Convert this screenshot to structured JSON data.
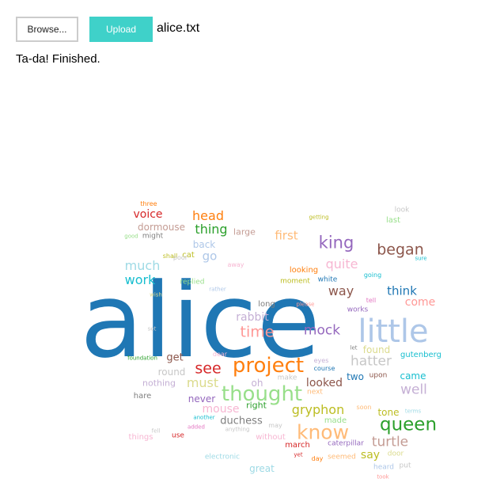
{
  "controls": {
    "browse_label": "Browse...",
    "upload_label": "Upload",
    "file_name": "alice.txt",
    "status": "Ta-da! Finished."
  },
  "word_cloud": {
    "words": [
      {
        "text": "alice",
        "color": "#1f77b4"
      },
      {
        "text": "little",
        "color": "#aec7e8"
      },
      {
        "text": "project",
        "color": "#ff7f0e"
      },
      {
        "text": "thought",
        "color": "#98df8a"
      },
      {
        "text": "know",
        "color": "#ffbb78"
      },
      {
        "text": "queen",
        "color": "#2ca02c"
      },
      {
        "text": "king",
        "color": "#9467bd"
      },
      {
        "text": "began",
        "color": "#8c564b"
      },
      {
        "text": "time",
        "color": "#ff9896"
      },
      {
        "text": "see",
        "color": "#d62728"
      },
      {
        "text": "mock",
        "color": "#9467bd"
      },
      {
        "text": "hatter",
        "color": "#c7c7c7"
      },
      {
        "text": "well",
        "color": "#c5b0d5"
      },
      {
        "text": "turtle",
        "color": "#c49c94"
      },
      {
        "text": "gryphon",
        "color": "#bcbd22"
      },
      {
        "text": "head",
        "color": "#ff7f0e"
      },
      {
        "text": "thing",
        "color": "#2ca02c"
      },
      {
        "text": "quite",
        "color": "#f7b6d2"
      },
      {
        "text": "much",
        "color": "#9edae5"
      },
      {
        "text": "work",
        "color": "#17becf"
      },
      {
        "text": "way",
        "color": "#8c564b"
      },
      {
        "text": "think",
        "color": "#1f77b4"
      },
      {
        "text": "must",
        "color": "#dbdb8d"
      },
      {
        "text": "voice",
        "color": "#d62728"
      },
      {
        "text": "first",
        "color": "#ffbb78"
      },
      {
        "text": "rabbit",
        "color": "#c5b0d5"
      },
      {
        "text": "looked",
        "color": "#8c564b"
      },
      {
        "text": "come",
        "color": "#ff9896"
      },
      {
        "text": "go",
        "color": "#aec7e8"
      },
      {
        "text": "say",
        "color": "#bcbd22"
      },
      {
        "text": "mouse",
        "color": "#f7b6d2"
      },
      {
        "text": "duchess",
        "color": "#7f7f7f"
      },
      {
        "text": "get",
        "color": "#8c564b"
      },
      {
        "text": "dormouse",
        "color": "#c49c94"
      },
      {
        "text": "back",
        "color": "#aec7e8"
      },
      {
        "text": "round",
        "color": "#c7c7c7"
      },
      {
        "text": "never",
        "color": "#9467bd"
      },
      {
        "text": "came",
        "color": "#17becf"
      },
      {
        "text": "two",
        "color": "#1f77b4"
      },
      {
        "text": "found",
        "color": "#dbdb8d"
      },
      {
        "text": "tone",
        "color": "#bcbd22"
      },
      {
        "text": "right",
        "color": "#2ca02c"
      },
      {
        "text": "oh",
        "color": "#c5b0d5"
      },
      {
        "text": "great",
        "color": "#9edae5"
      },
      {
        "text": "large",
        "color": "#c49c94"
      },
      {
        "text": "cat",
        "color": "#bcbd22"
      },
      {
        "text": "nothing",
        "color": "#c5b0d5"
      },
      {
        "text": "made",
        "color": "#98df8a"
      },
      {
        "text": "looking",
        "color": "#ff7f0e"
      },
      {
        "text": "long",
        "color": "#7f7f7f"
      },
      {
        "text": "gutenberg",
        "color": "#17becf"
      },
      {
        "text": "march",
        "color": "#d62728"
      },
      {
        "text": "without",
        "color": "#f7b6d2"
      },
      {
        "text": "caterpillar",
        "color": "#9467bd"
      },
      {
        "text": "last",
        "color": "#98df8a"
      },
      {
        "text": "things",
        "color": "#f7b6d2"
      },
      {
        "text": "hare",
        "color": "#7f7f7f"
      },
      {
        "text": "heard",
        "color": "#aec7e8"
      },
      {
        "text": "works",
        "color": "#9467bd"
      },
      {
        "text": "moment",
        "color": "#bcbd22"
      },
      {
        "text": "white",
        "color": "#1f77b4"
      },
      {
        "text": "course",
        "color": "#1f77b4"
      },
      {
        "text": "make",
        "color": "#c7c7c7"
      },
      {
        "text": "put",
        "color": "#c7c7c7"
      },
      {
        "text": "door",
        "color": "#dbdb8d"
      },
      {
        "text": "upon",
        "color": "#8c564b"
      },
      {
        "text": "next",
        "color": "#ffbb78"
      },
      {
        "text": "seemed",
        "color": "#ffbb78"
      },
      {
        "text": "electronic",
        "color": "#9edae5"
      },
      {
        "text": "replied",
        "color": "#98df8a"
      },
      {
        "text": "anything",
        "color": "#c7c7c7"
      },
      {
        "text": "going",
        "color": "#17becf"
      },
      {
        "text": "tell",
        "color": "#e377c2"
      },
      {
        "text": "away",
        "color": "#f7b6d2"
      },
      {
        "text": "shall",
        "color": "#bcbd22"
      },
      {
        "text": "might",
        "color": "#7f7f7f"
      },
      {
        "text": "poor",
        "color": "#c7c7c7"
      },
      {
        "text": "use",
        "color": "#d62728"
      },
      {
        "text": "dear",
        "color": "#f7b6d2"
      },
      {
        "text": "eyes",
        "color": "#c5b0d5"
      },
      {
        "text": "soon",
        "color": "#ffbb78"
      },
      {
        "text": "terms",
        "color": "#9edae5"
      },
      {
        "text": "look",
        "color": "#c7c7c7"
      },
      {
        "text": "three",
        "color": "#ff7f0e"
      },
      {
        "text": "getting",
        "color": "#bcbd22"
      },
      {
        "text": "good",
        "color": "#98df8a"
      },
      {
        "text": "sure",
        "color": "#17becf"
      },
      {
        "text": "rather",
        "color": "#aec7e8"
      },
      {
        "text": "wish",
        "color": "#dbdb8d"
      },
      {
        "text": "please",
        "color": "#ff9896"
      },
      {
        "text": "set",
        "color": "#c7c7c7"
      },
      {
        "text": "let",
        "color": "#7f7f7f"
      },
      {
        "text": "foundation",
        "color": "#2ca02c"
      },
      {
        "text": "fell",
        "color": "#c7c7c7"
      },
      {
        "text": "another",
        "color": "#17becf"
      },
      {
        "text": "added",
        "color": "#e377c2"
      },
      {
        "text": "may",
        "color": "#c7c7c7"
      },
      {
        "text": "yet",
        "color": "#d62728"
      },
      {
        "text": "day",
        "color": "#ff7f0e"
      },
      {
        "text": "took",
        "color": "#ff9896"
      }
    ]
  }
}
